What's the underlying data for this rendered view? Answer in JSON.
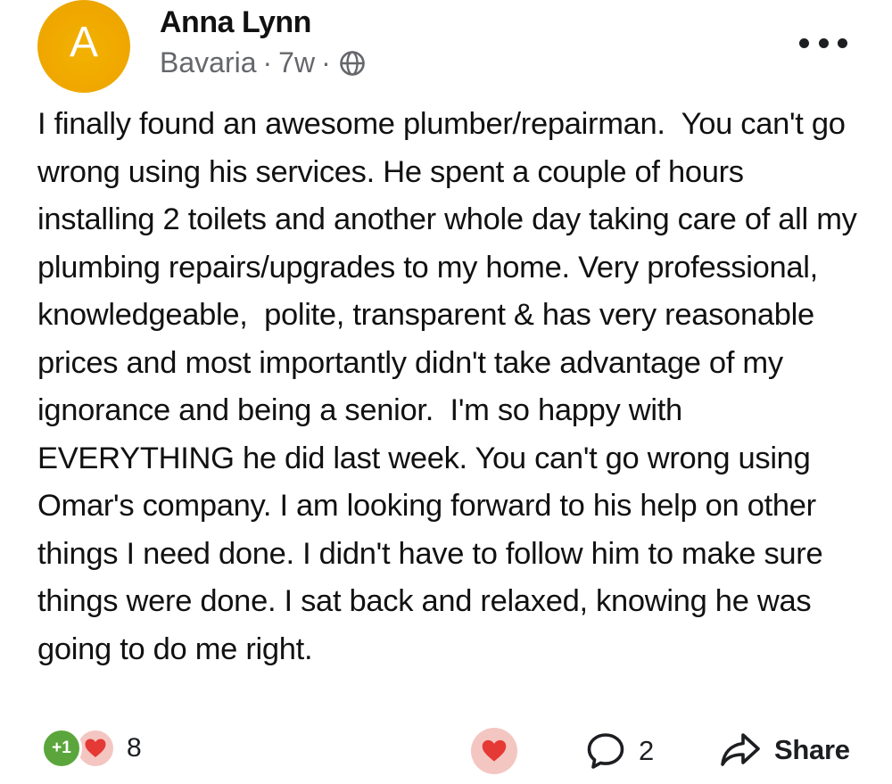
{
  "post": {
    "author": {
      "avatar_letter": "A",
      "avatar_color": "#f0a800",
      "name": "Anna Lynn"
    },
    "meta": {
      "location": "Bavaria",
      "separator": "·",
      "time": "7w",
      "audience_icon": "globe-icon"
    },
    "more_icon": "more-horizontal-icon",
    "body": "I finally found an awesome plumber/repairman.  You can't go wrong using his services. He spent a couple of hours installing 2 toilets and another whole day taking care of all my plumbing repairs/upgrades to my home. Very professional, knowledgeable,  polite, transparent & has very reasonable prices and most importantly didn't take advantage of my ignorance and being a senior.  I'm so happy with EVERYTHING he did last week. You can't go wrong using Omar's company. I am looking forward to his help on other things I need done. I didn't have to follow him to make sure things were done. I sat back and relaxed, knowing he was going to do me right."
  },
  "footer": {
    "reactions": {
      "plus_one_label": "+1",
      "plus_one_color": "#5aa63c",
      "heart_icon": "heart-icon",
      "heart_color": "#e53935",
      "count": "8"
    },
    "like_button_icon": "heart-icon",
    "comment": {
      "icon": "comment-icon",
      "count": "2"
    },
    "share": {
      "icon": "share-icon",
      "label": "Share"
    }
  }
}
